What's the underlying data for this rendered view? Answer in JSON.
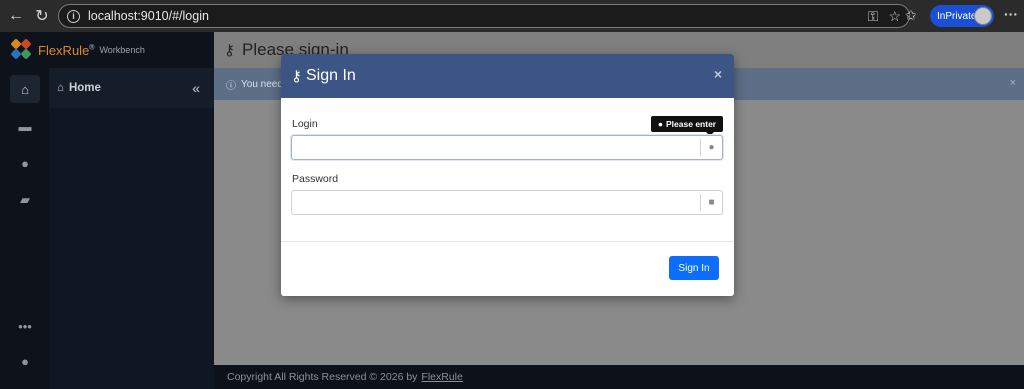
{
  "browser": {
    "url": "localhost:9010/#/login",
    "inprivate_label": "InPrivate"
  },
  "app": {
    "logo_name": "FlexRule",
    "logo_reg": "®",
    "logo_sub": "Workbench",
    "side_home": "Home",
    "page_title": "Please sign-in",
    "alert_text": "You need",
    "footer_text": "Copyright All Rights Reserved © 2026 by",
    "footer_link": "FlexRule"
  },
  "modal": {
    "title": "Sign In",
    "login_label": "Login",
    "login_value": "",
    "password_label": "Password",
    "password_value": "",
    "tooltip": "Please enter",
    "signin_button": "Sign In"
  },
  "colors": {
    "modal_header": "#3c5585",
    "primary_button": "#0d6efd",
    "inprivate": "#1a4fd6"
  }
}
